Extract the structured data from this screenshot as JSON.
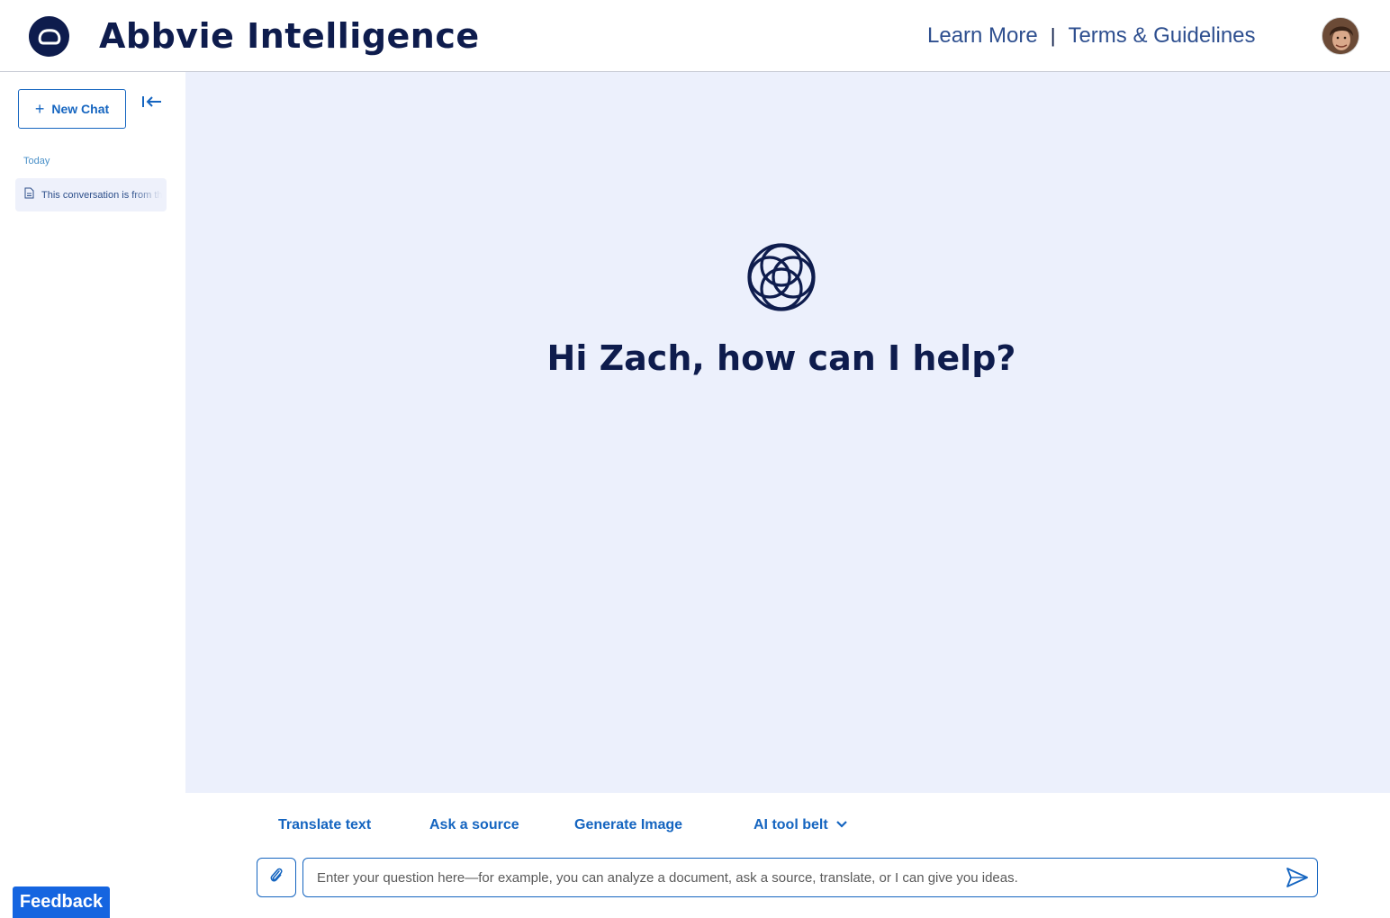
{
  "header": {
    "app_title": "Abbvie Intelligence",
    "learn_more": "Learn More",
    "separator": "|",
    "terms": "Terms & Guidelines"
  },
  "sidebar": {
    "new_chat_label": "New Chat",
    "section_label": "Today",
    "conversations": [
      {
        "label": "This conversation is from the"
      }
    ]
  },
  "main": {
    "greeting": "Hi Zach, how can I help?"
  },
  "tools": {
    "translate": "Translate text",
    "ask_source": "Ask a source",
    "generate_image": "Generate Image",
    "tool_belt": "AI tool belt"
  },
  "input": {
    "placeholder": "Enter your question here—for example, you can analyze a document, ask a source, translate, or I can give you ideas."
  },
  "feedback_label": "Feedback",
  "colors": {
    "brand_navy": "#0e1c4d",
    "accent_blue": "#1565c0",
    "main_bg": "#ecf0fc",
    "feedback_bg": "#1565e0"
  },
  "icons": {
    "logo": "abbvie-logo-icon",
    "collapse": "collapse-sidebar-icon",
    "conversation": "document-icon",
    "brand_mark": "abbvie-intelligence-mark-icon",
    "attach": "paperclip-icon",
    "send": "send-icon",
    "chevron": "chevron-down-icon"
  }
}
